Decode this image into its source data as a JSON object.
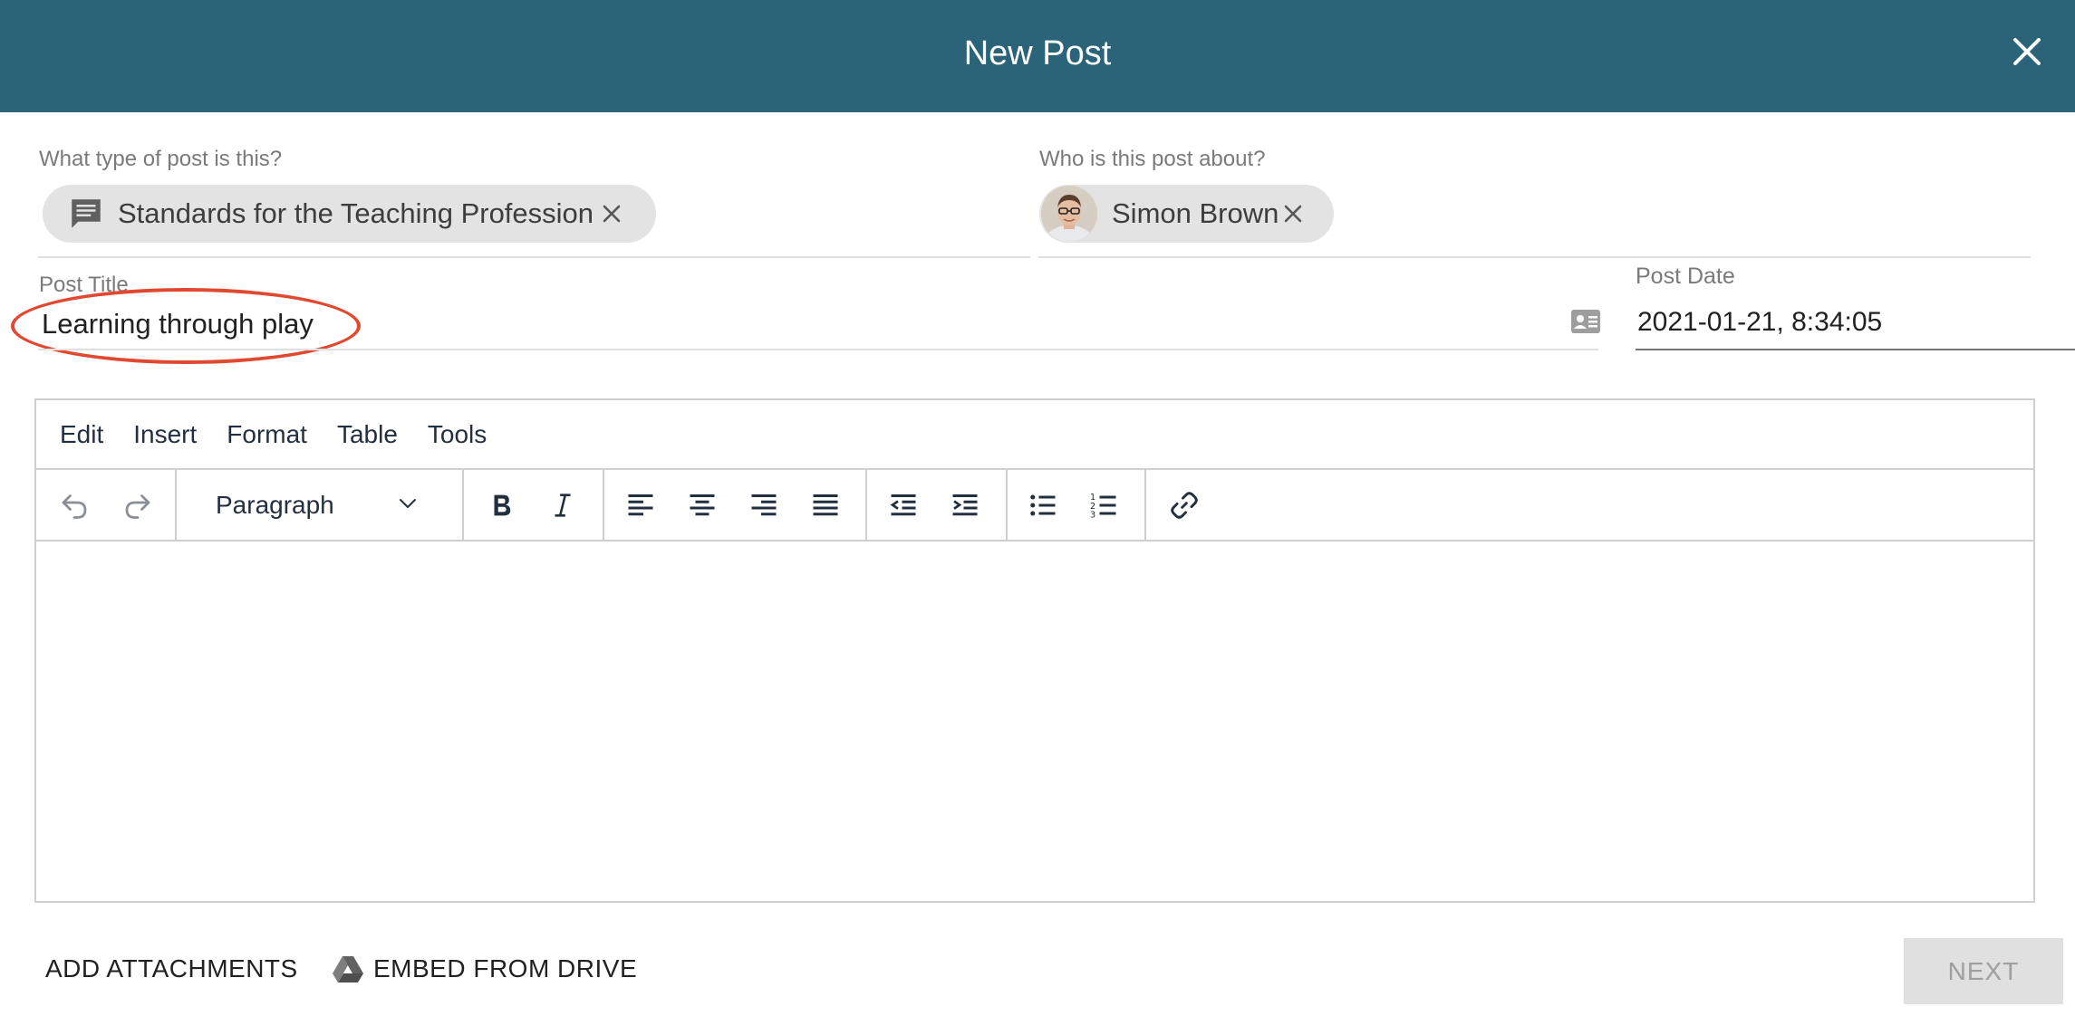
{
  "header": {
    "title": "New Post"
  },
  "post_type": {
    "label": "What type of post is this?",
    "chip_label": "Standards for the Teaching Profession",
    "chip_icon": "comment-icon"
  },
  "post_about": {
    "label": "Who is this post about?",
    "chip_label": "Simon Brown"
  },
  "post_title": {
    "label": "Post Title",
    "value": "Learning through play"
  },
  "post_date": {
    "label": "Post Date",
    "value": "2021-01-21, 8:34:05"
  },
  "editor": {
    "menu": [
      "Edit",
      "Insert",
      "Format",
      "Table",
      "Tools"
    ],
    "block_format": "Paragraph"
  },
  "footer": {
    "add_attachments": "ADD ATTACHMENTS",
    "embed_drive": "EMBED FROM DRIVE",
    "next": "NEXT"
  },
  "colors": {
    "header_bg": "#2b6479",
    "annotation": "#e0492f",
    "chip_bg": "#e3e3e3"
  }
}
